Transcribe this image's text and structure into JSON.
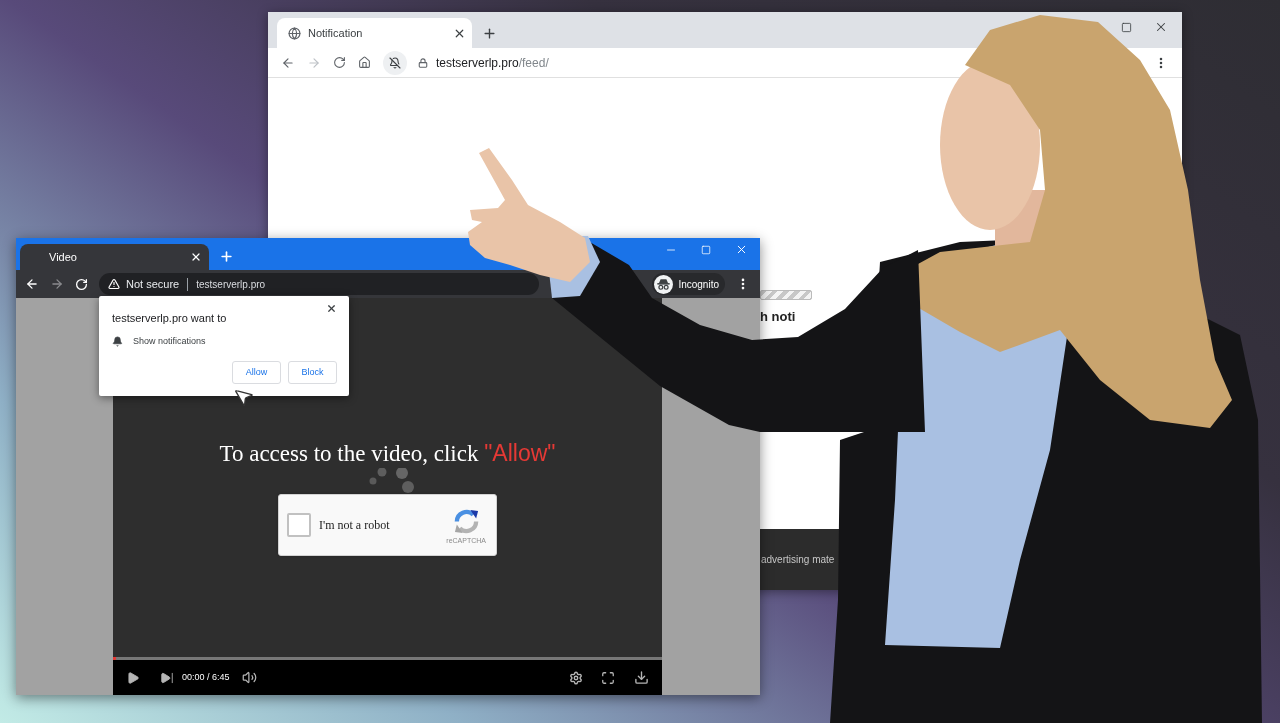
{
  "back_window": {
    "tabs": [
      {
        "title": "Notification",
        "selected": true
      }
    ],
    "toolbar": {
      "forward_disabled": true
    },
    "address": {
      "host": "testserverlp.pro",
      "path": "/feed/"
    },
    "page": {
      "heading": "h noti",
      "footer": "advertising mate"
    }
  },
  "front_window": {
    "tabs": [
      {
        "title": "Video",
        "selected": true
      }
    ],
    "toolbar": {
      "forward_disabled": true
    },
    "address": {
      "security": "Not secure",
      "url": "testserverlp.pro"
    },
    "incognito": "Incognito",
    "permission_popup": {
      "title": "testserverlp.pro want to",
      "request": "Show notifications",
      "buttons": [
        "Allow",
        "Block"
      ]
    },
    "video": {
      "instruction": "To access to the video, click",
      "highlight": "\"Allow\"",
      "captcha": {
        "label": "I'm not a robot",
        "checked": false,
        "brand": "reCAPTCHA"
      },
      "progress": {
        "level": 0
      },
      "time": "00:00 / 6:45"
    }
  }
}
